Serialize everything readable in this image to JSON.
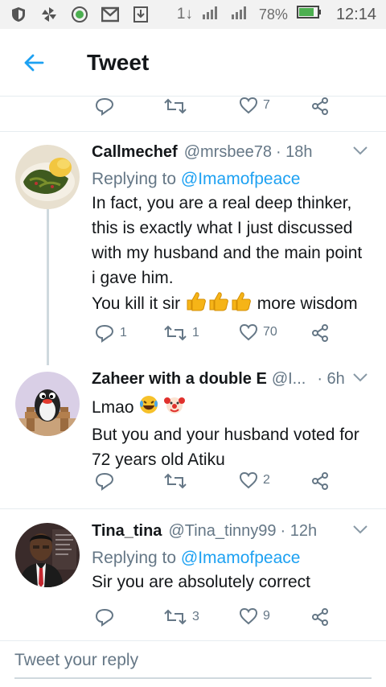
{
  "status_bar": {
    "icons": [
      "shield-icon",
      "pinwheel-icon",
      "record-icon",
      "gmail-icon",
      "download-icon"
    ],
    "network1": "1↓",
    "network2": "H",
    "battery_pct": "78%",
    "time": "12:14"
  },
  "header": {
    "title": "Tweet"
  },
  "top_actions": {
    "likes": "7"
  },
  "tweets": [
    {
      "name": "Callmechef",
      "handle": "@mrsbee78",
      "time": "· 18h",
      "replying_label": "Replying to",
      "replying_to": "@Imamofpeace",
      "text_lines": [
        "In fact, you are a real deep thinker,",
        "this is exactly what I just discussed",
        "with my husband and the main point",
        "i gave him.",
        "You kill it sir"
      ],
      "text_tail": "more wisdom",
      "replies": "1",
      "retweets": "1",
      "likes": "70"
    },
    {
      "name": "Zaheer with a double E",
      "handle": "@I...",
      "time": "· 6h",
      "line1": "Lmao",
      "text_lines": [
        "But you and your husband voted for",
        "72 years old Atiku"
      ],
      "replies": "",
      "retweets": "",
      "likes": "2"
    },
    {
      "name": "Tina_tina",
      "handle": "@Tina_tinny99",
      "time": "· 12h",
      "replying_label": "Replying to",
      "replying_to": "@Imamofpeace",
      "text_lines": [
        "Sir you are absolutely correct"
      ],
      "replies": "",
      "retweets": "3",
      "likes": "9"
    }
  ],
  "reply_box": {
    "placeholder": "Tweet your reply"
  },
  "colors": {
    "accent": "#1da1f2",
    "secondary_text": "#657786",
    "divider": "#e6ecf0"
  }
}
